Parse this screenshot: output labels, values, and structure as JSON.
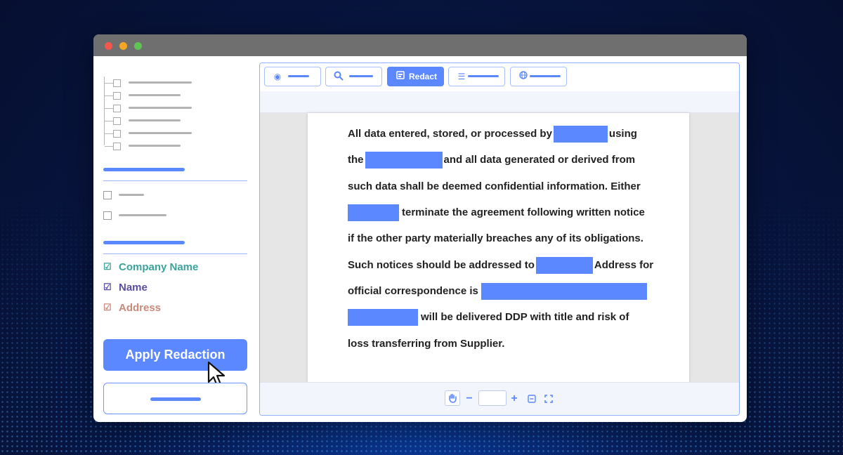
{
  "toolbar": {
    "redact_label": "Redact"
  },
  "sidebar": {
    "entity_options": [
      {
        "label": "Company Name",
        "color": "#3aa39a",
        "checked": true
      },
      {
        "label": "Name",
        "color": "#5a4da0",
        "checked": true
      },
      {
        "label": "Address",
        "color": "#c98a79",
        "checked": true
      }
    ],
    "apply_button_label": "Apply Redaction"
  },
  "document": {
    "lines": [
      [
        "All data entered, stored, or processed by",
        "using"
      ],
      [
        "the",
        "and all data generated or derived from"
      ],
      [
        "such data shall be deemed confidential information. Either"
      ],
      [
        "terminate the agreement following written notice"
      ],
      [
        "if the other party materially breaches any of its obligations."
      ],
      [
        "Such notices should be addressed to",
        "Address for"
      ],
      [
        "official correspondence is"
      ],
      [
        "will be delivered DDP with title and risk of"
      ],
      [
        "loss transferring from Supplier."
      ]
    ]
  },
  "colors": {
    "accent": "#5b87ff",
    "titlebar": "#6f6f6f"
  }
}
